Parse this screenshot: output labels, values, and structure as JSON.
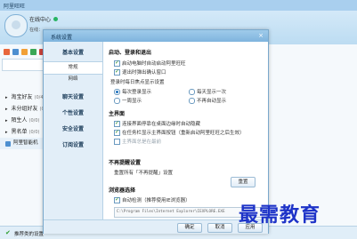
{
  "main_window": {
    "title": "阿里旺旺",
    "status_text": "在线中心",
    "signature": "在线：",
    "search_placeholder": "",
    "groups": [
      {
        "label": "淘宝好友",
        "count": "(0/4)"
      },
      {
        "label": "未分组好友",
        "count": "(0/1)"
      },
      {
        "label": "陌生人",
        "count": "(0/0)"
      },
      {
        "label": "黑名单",
        "count": "(0/0)"
      }
    ],
    "entry_label": "阿里智能机",
    "bottom_label": "推荐类的设置"
  },
  "dialog": {
    "title": "系统设置",
    "close_glyph": "×",
    "nav": {
      "basic": "基本设置",
      "general": "常规",
      "network": "网络",
      "chat": "聊天设置",
      "personal": "个性设置",
      "security": "安全设置",
      "subscription": "订阅设置"
    },
    "sections": {
      "startup_title": "启动、登录和退出",
      "startup_options": [
        "启动电脑时自动启动阿里旺旺",
        "退出时弹出确认窗口"
      ],
      "login_prompt": "登录时每日焦点显示设置",
      "radio_row1": [
        "每次登录显示",
        "每天显示一次"
      ],
      "radio_row2": [
        "一周显示",
        "不再自动显示"
      ],
      "main_ui_title": "主界面",
      "main_ui_options": [
        "连接界面停靠在桌面边缘时自动隐藏",
        "在任务栏显示主界面按钮（重新启动阿里旺旺之后生效）",
        "主界面总是在最前"
      ],
      "no_remind_title": "不再提醒设置",
      "no_remind_text": "重置所有「不再提醒」设置",
      "reset_button": "重置",
      "browser_title": "浏览器选择",
      "browser_option": "自动检测（推荐使用IE浏览器）",
      "browser_path": "C:\\Program Files\\Internet Explorer\\IEXPLORE.EXE"
    },
    "footer": {
      "ok": "确定",
      "cancel": "取消",
      "apply": "应用"
    }
  },
  "watermark": "最需教育",
  "colors": {
    "accent": "#7fb4de",
    "check": "#1c8a1c",
    "watermark": "#1d33c8",
    "status_online": "#28b463"
  }
}
